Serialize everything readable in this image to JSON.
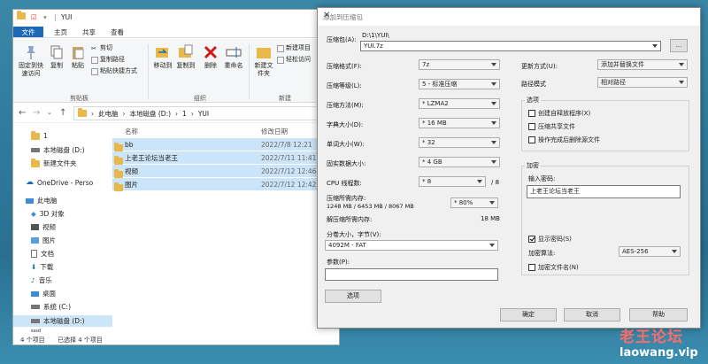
{
  "explorer": {
    "title": "YUI",
    "tabs": [
      "文件",
      "主页",
      "共享",
      "查看"
    ],
    "ribbon": {
      "pin_label": "固定到快速访问",
      "copy_label": "复制",
      "paste_label": "粘贴",
      "cut_label": "剪切",
      "copy_path_label": "复制路径",
      "paste_shortcut_label": "粘贴快捷方式",
      "clipboard_group": "剪贴板",
      "move_to_label": "移动到",
      "copy_to_label": "复制到",
      "delete_label": "删除",
      "rename_label": "重命名",
      "organize_group": "组织",
      "new_folder_label": "新建文件夹",
      "new_item_label": "新建项目",
      "easy_access_label": "轻松访问",
      "new_group": "新建"
    },
    "address": [
      "此电脑",
      "本地磁盘 (D:)",
      "1",
      "YUI"
    ],
    "nav": [
      {
        "label": "1"
      },
      {
        "label": "本地磁盘 (D:)"
      },
      {
        "label": "新建文件夹"
      },
      {
        "label": "OneDrive - Perso"
      },
      {
        "label": "此电脑"
      },
      {
        "label": "3D 对象"
      },
      {
        "label": "视频"
      },
      {
        "label": "图片"
      },
      {
        "label": "文档"
      },
      {
        "label": "下载"
      },
      {
        "label": "音乐"
      },
      {
        "label": "桌面"
      },
      {
        "label": "系统 (C:)"
      },
      {
        "label": "本地磁盘 (D:)"
      },
      {
        "label": "sssd"
      }
    ],
    "columns": {
      "name": "名称",
      "modified": "修改日期"
    },
    "files": [
      {
        "name": "bb",
        "date": "2022/7/8 12:21"
      },
      {
        "name": "上老王论坛当老王",
        "date": "2022/7/11 11:41"
      },
      {
        "name": "视频",
        "date": "2022/7/12 12:46"
      },
      {
        "name": "图片",
        "date": "2022/7/12 12:42"
      }
    ],
    "status_count": "4 个项目",
    "status_selected": "已选择 4 个项目"
  },
  "dialog": {
    "title": "添加到压缩包",
    "archive_label": "压缩包(A):",
    "archive_path": "D:\\1\\YUI\\",
    "archive_name": "YUI.7z",
    "browse_label": "...",
    "format_label": "压缩格式(F):",
    "format_value": "7z",
    "level_label": "压缩等级(L):",
    "level_value": "5 - 标准压缩",
    "method_label": "压缩方法(M):",
    "method_value": "* LZMA2",
    "dict_label": "字典大小(D):",
    "dict_value": "* 16 MB",
    "word_label": "单词大小(W):",
    "word_value": "* 32",
    "solid_label": "固实数据大小:",
    "solid_value": "* 4 GB",
    "threads_label": "CPU 线程数:",
    "threads_value": "* 8",
    "threads_max": "/ 8",
    "mem_comp_label": "压缩所需内存:",
    "mem_comp_value": "1248 MB / 6453 MB / 8067 MB",
    "mem_percent": "* 80%",
    "mem_decomp_label": "解压缩所需内存:",
    "mem_decomp_value": "18 MB",
    "split_label": "分卷大小，字节(V):",
    "split_value": "4092M - FAT",
    "params_label": "参数(P):",
    "params_value": "",
    "options_button": "选项",
    "update_label": "更新方式(U):",
    "update_value": "添加并替换文件",
    "path_mode_label": "路径模式",
    "path_mode_value": "相对路径",
    "options_group": "选项",
    "sfx_label": "创建自释放程序(X)",
    "shared_label": "压缩共享文件",
    "delete_after_label": "操作完成后删除源文件",
    "encrypt_group": "加密",
    "password_label": "输入密码:",
    "password_value": "上老王论坛当老王",
    "show_password_label": "显示密码(S)",
    "enc_method_label": "加密算法:",
    "enc_method_value": "AES-256",
    "enc_names_label": "加密文件名(N)",
    "ok_button": "确定",
    "cancel_button": "取消",
    "help_button": "帮助"
  },
  "watermark": {
    "line1": "老王论坛",
    "line2": "laowang.vip"
  }
}
